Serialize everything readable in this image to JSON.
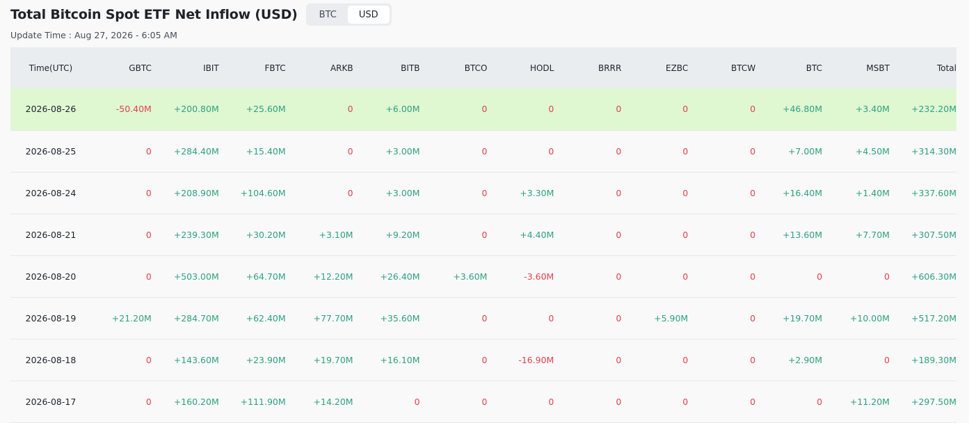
{
  "header": {
    "title": "Total Bitcoin Spot ETF Net Inflow (USD)",
    "update_time": "Update Time : Aug 27, 2026 - 6:05 AM"
  },
  "toggle": {
    "options": [
      "BTC",
      "USD"
    ],
    "active": "USD"
  },
  "colors": {
    "positive": "#2ea17f",
    "negative": "#e0424f",
    "highlight_row": "#dff8d2",
    "header_bg": "#e9edf0"
  },
  "table": {
    "columns": [
      "Time(UTC)",
      "GBTC",
      "IBIT",
      "FBTC",
      "ARKB",
      "BITB",
      "BTCO",
      "HODL",
      "BRRR",
      "EZBC",
      "BTCW",
      "BTC",
      "MSBT",
      "Total"
    ],
    "rows": [
      {
        "date": "2026-08-26",
        "highlight": true,
        "cells": [
          "-50.40M",
          "+200.80M",
          "+25.60M",
          "0",
          "+6.00M",
          "0",
          "0",
          "0",
          "0",
          "0",
          "+46.80M",
          "+3.40M",
          "+232.20M"
        ]
      },
      {
        "date": "2026-08-25",
        "highlight": false,
        "cells": [
          "0",
          "+284.40M",
          "+15.40M",
          "0",
          "+3.00M",
          "0",
          "0",
          "0",
          "0",
          "0",
          "+7.00M",
          "+4.50M",
          "+314.30M"
        ]
      },
      {
        "date": "2026-08-24",
        "highlight": false,
        "cells": [
          "0",
          "+208.90M",
          "+104.60M",
          "0",
          "+3.00M",
          "0",
          "+3.30M",
          "0",
          "0",
          "0",
          "+16.40M",
          "+1.40M",
          "+337.60M"
        ]
      },
      {
        "date": "2026-08-21",
        "highlight": false,
        "cells": [
          "0",
          "+239.30M",
          "+30.20M",
          "+3.10M",
          "+9.20M",
          "0",
          "+4.40M",
          "0",
          "0",
          "0",
          "+13.60M",
          "+7.70M",
          "+307.50M"
        ]
      },
      {
        "date": "2026-08-20",
        "highlight": false,
        "cells": [
          "0",
          "+503.00M",
          "+64.70M",
          "+12.20M",
          "+26.40M",
          "+3.60M",
          "-3.60M",
          "0",
          "0",
          "0",
          "0",
          "0",
          "+606.30M"
        ]
      },
      {
        "date": "2026-08-19",
        "highlight": false,
        "cells": [
          "+21.20M",
          "+284.70M",
          "+62.40M",
          "+77.70M",
          "+35.60M",
          "0",
          "0",
          "0",
          "+5.90M",
          "0",
          "+19.70M",
          "+10.00M",
          "+517.20M"
        ]
      },
      {
        "date": "2026-08-18",
        "highlight": false,
        "cells": [
          "0",
          "+143.60M",
          "+23.90M",
          "+19.70M",
          "+16.10M",
          "0",
          "-16.90M",
          "0",
          "0",
          "0",
          "+2.90M",
          "0",
          "+189.30M"
        ]
      },
      {
        "date": "2026-08-17",
        "highlight": false,
        "cells": [
          "0",
          "+160.20M",
          "+111.90M",
          "+14.20M",
          "0",
          "0",
          "0",
          "0",
          "0",
          "0",
          "0",
          "+11.20M",
          "+297.50M"
        ]
      }
    ]
  }
}
